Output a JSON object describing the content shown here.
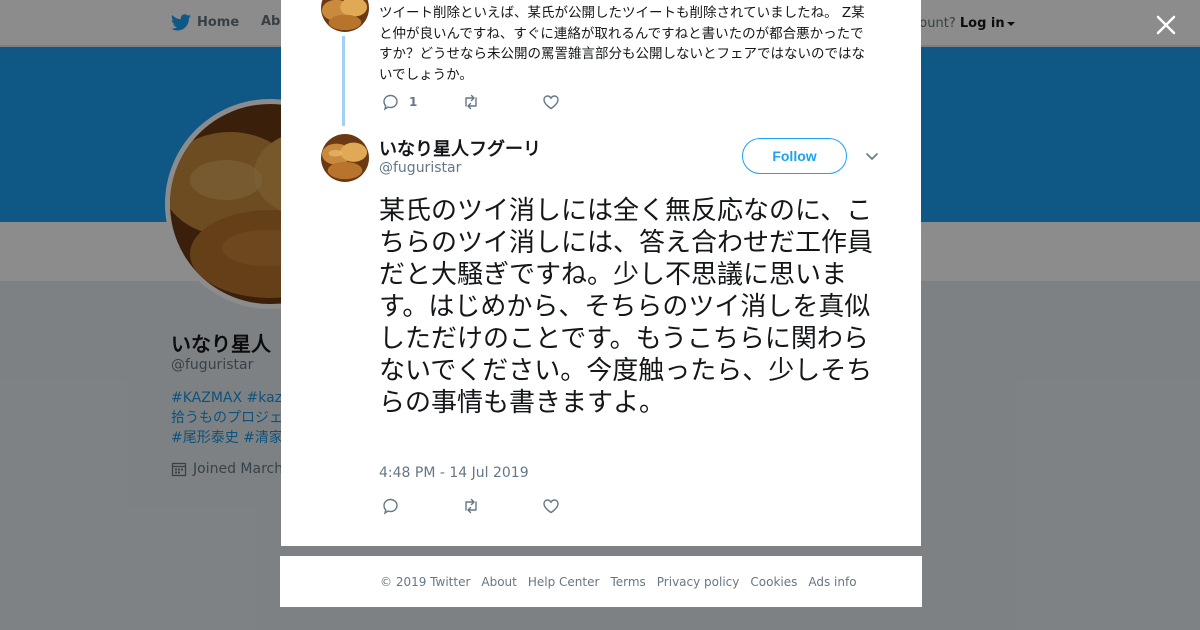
{
  "nav": {
    "home_label": "Home",
    "about_label": "Abo",
    "account_prompt": "ccount?",
    "login_label": "Log in"
  },
  "profile": {
    "name": "いなり星人",
    "handle": "@fuguristar",
    "bio_lines": [
      "#KAZMAX #kazm",
      "拾うものプロジェ",
      "#尾形泰史 #清家孝"
    ],
    "joined": "Joined March"
  },
  "parent_tweet": {
    "text": "ツイート削除といえば、某氏が公開したツイートも削除されていましたね。 Z某と仲が良いんですね、すぐに連絡が取れるんですねと書いたのが都合悪かったですか？どうせなら未公開の罵詈雑言部分も公開しないとフェアではないのではないでしょうか。",
    "reply_count": "1"
  },
  "tweet": {
    "author_name": "いなり星人フグーリ",
    "author_handle": "@fuguristar",
    "follow_label": "Follow",
    "text": "某氏のツイ消しには全く無反応なのに、こちらのツイ消しには、答え合わせだ工作員だと大騒ぎですね。少し不思議に思います。はじめから、そちらのツイ消しを真似しただけのことです。もうこちらに関わらないでください。今度触ったら、少しそちらの事情も書きますよ。",
    "timestamp": "4:48 PM - 14 Jul 2019"
  },
  "footer": {
    "copyright": "© 2019 Twitter",
    "links": [
      "About",
      "Help Center",
      "Terms",
      "Privacy policy",
      "Cookies",
      "Ads info"
    ]
  },
  "colors": {
    "brand": "#1da1f2",
    "banner": "#1da1f2",
    "thread_line": "#a2d1f5",
    "muted": "#657786"
  },
  "icons": [
    "twitter-bird-icon",
    "close-icon",
    "reply-icon",
    "retweet-icon",
    "like-icon",
    "chevron-down-icon",
    "calendar-icon"
  ]
}
